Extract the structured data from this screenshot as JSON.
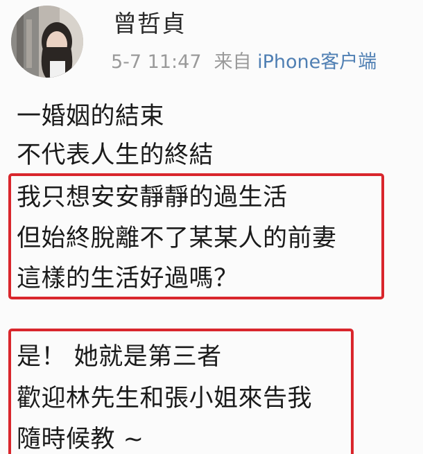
{
  "post": {
    "author": "曾哲貞",
    "time": "5-7 11:47",
    "source_prefix": "来自",
    "source_client": "iPhone客户端",
    "lines": [
      "一婚姻的結束",
      "不代表人生的終結",
      "我只想安安靜靜的過生活",
      "但始終脫離不了某某人的前妻",
      "這樣的生活好過嗎？",
      "是！ 她就是第三者",
      "歡迎林先生和張小姐來告我",
      "隨時候教 ~"
    ]
  },
  "colors": {
    "highlight_border": "#d9262c",
    "link_blue": "#4f7fb3",
    "meta_gray": "#9a9a9a"
  }
}
